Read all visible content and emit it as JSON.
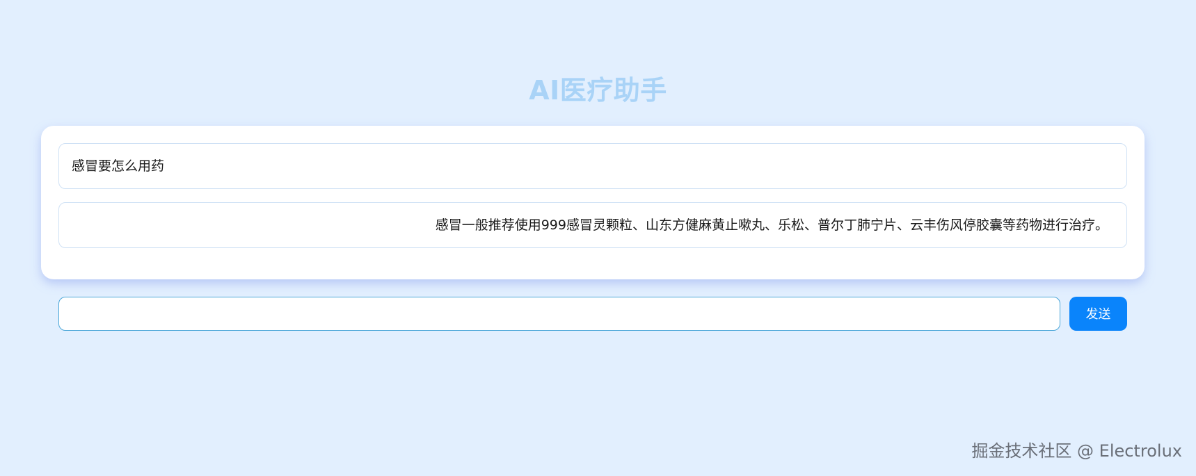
{
  "header": {
    "title": "AI医疗助手"
  },
  "chat": {
    "messages": [
      {
        "role": "user",
        "text": "感冒要怎么用药"
      },
      {
        "role": "assistant",
        "text": "感冒一般推荐使用999感冒灵颗粒、山东方健麻黄止嗽丸、乐松、普尔丁肺宁片、云丰伤风停胶囊等药物进行治疗。"
      }
    ]
  },
  "composer": {
    "input_value": "",
    "input_placeholder": "",
    "send_label": "发送"
  },
  "watermark": {
    "text": "掘金技术社区 @ Electrolux"
  },
  "colors": {
    "page_background": "#e2effe",
    "title": "#a9d3f7",
    "send_button": "#0a84fb",
    "input_border": "#4aa6d8"
  }
}
